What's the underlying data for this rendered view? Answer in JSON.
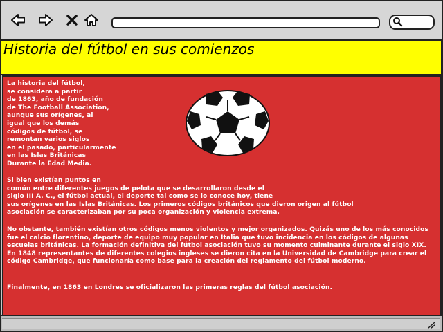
{
  "browser": {
    "icons": {
      "back": "arrow-left-icon",
      "forward": "arrow-right-icon",
      "close": "close-icon",
      "home": "home-icon",
      "search": "search-icon",
      "resize": "resize-grip-icon"
    },
    "address": "",
    "search": ""
  },
  "page": {
    "title": "Historia del fútbol en sus comienzos",
    "image": "soccer-ball",
    "paragraphs": {
      "intro": "La historia del fútbol,\nse considera a partir\nde 1863, año de fundación\nde The Football Association,\naunque sus orígenes, al\nigual que los demás\ncódigos de fútbol, se\nremontan varios siglos\nen el pasado, particularmente\nen las Islas Británicas\nDurante la Edad Media.",
      "p2": "Si bien existían puntos en\n común entre diferentes juegos de pelota que se desarrollaron desde el\nsiglo III A. C., el fútbol actual, el deporte tal como se lo conoce hoy, tiene\nsus orígenes en las Islas Británicas. Los primeros códigos británicos que dieron origen al fútbol\nasociación se caracterizaban por su poca organización y violencia extrema.",
      "p3": "No obstante, también existían otros códigos menos violentos y mejor organizados. Quizás uno de los más conocidos fue el calcio florentino, deporte de equipo muy popular en Italia que tuvo incidencia en los códigos de algunas escuelas británicas. La formación definitiva del fútbol asociación tuvo su momento culminante durante el siglo XIX. En 1848 representantes de diferentes colegios ingleses se dieron cita en la Universidad de Cambridge para crear el código Cambridge, que funcionaría como base para la creación del reglamento del fútbol moderno.",
      "p4": "Finalmente, en 1863 en Londres se oficializaron las primeras reglas del  fútbol asociación."
    }
  },
  "colors": {
    "titleBackground": "#ffff00",
    "contentBackground": "#d63030",
    "contentText": "#ffffff",
    "chrome": "#d6d6d6"
  }
}
